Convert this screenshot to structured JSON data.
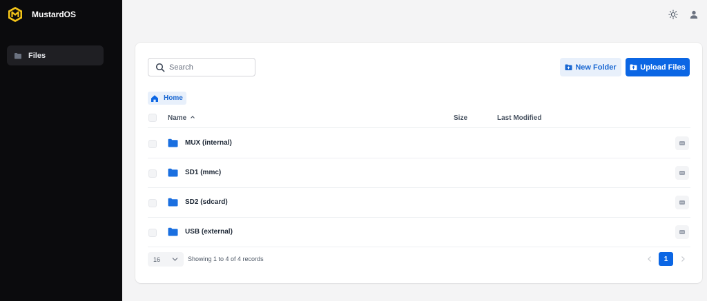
{
  "app": {
    "name": "MustardOS"
  },
  "sidebar": {
    "items": [
      {
        "label": "Files",
        "icon": "folder-icon",
        "active": true
      }
    ]
  },
  "topbar": {
    "icons": [
      "sun-icon",
      "user-icon"
    ]
  },
  "toolbar": {
    "search_placeholder": "Search",
    "new_folder_label": "New Folder",
    "upload_label": "Upload Files"
  },
  "breadcrumb": {
    "home_label": "Home"
  },
  "table": {
    "columns": {
      "name": "Name",
      "size": "Size",
      "modified": "Last Modified"
    },
    "sort": {
      "column": "Name",
      "direction": "ascending"
    },
    "rows": [
      {
        "name": "MUX (internal)"
      },
      {
        "name": "SD1 (mmc)"
      },
      {
        "name": "SD2 (sdcard)"
      },
      {
        "name": "USB (external)"
      }
    ]
  },
  "footer": {
    "per_page": "16",
    "records_text": "Showing 1 to 4 of 4 records",
    "current_page": "1"
  },
  "colors": {
    "accent": "#0b66e4",
    "accent_light": "#e8f0fb",
    "sidebar_bg": "#0b0b0d",
    "brand_logo": "#f5c518"
  }
}
